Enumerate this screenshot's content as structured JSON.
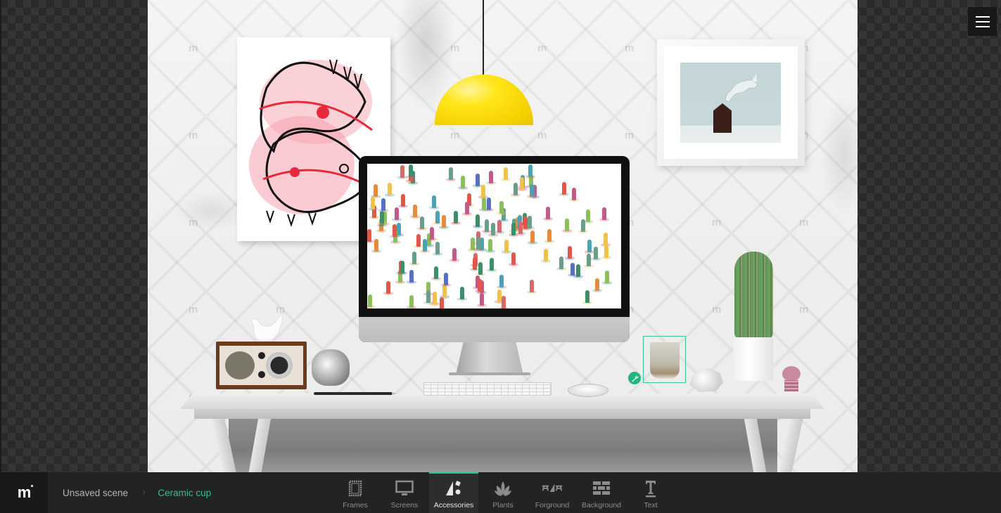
{
  "canvas": {
    "wall_color": "#f2f2f2",
    "watermark_glyph": "m",
    "selected_item": "Ceramic cup",
    "lamp_color": "#ffe619",
    "selection_color": "#3ec291"
  },
  "menu": {
    "icon": "hamburger-icon"
  },
  "bottom_bar": {
    "logo_text": "m",
    "breadcrumb": {
      "root": "Unsaved scene",
      "separator": "›",
      "current": "Ceramic cup"
    },
    "accent_color": "#2fc28c",
    "tabs": [
      {
        "label": "Frames",
        "icon": "frame-icon",
        "active": false
      },
      {
        "label": "Screens",
        "icon": "monitor-icon",
        "active": false
      },
      {
        "label": "Accessories",
        "icon": "shapes-icon",
        "active": true
      },
      {
        "label": "Plants",
        "icon": "plant-icon",
        "active": false
      },
      {
        "label": "Forground",
        "icon": "foreground-icon",
        "active": false
      },
      {
        "label": "Background",
        "icon": "brick-wall-icon",
        "active": false
      },
      {
        "label": "Text",
        "icon": "text-icon",
        "active": false
      }
    ]
  }
}
